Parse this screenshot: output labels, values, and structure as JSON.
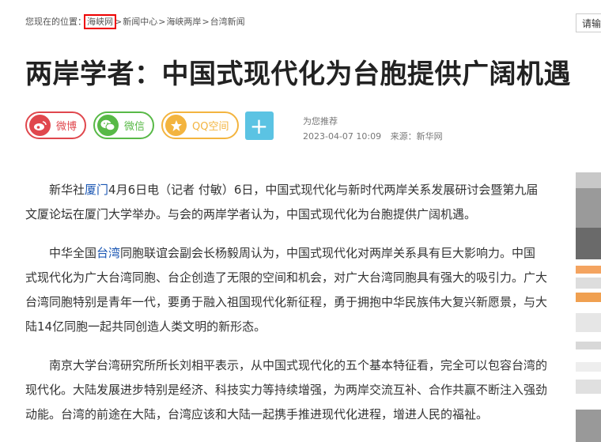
{
  "breadcrumb": {
    "prefix": "您现在的位置：",
    "items": [
      "海峡网",
      "新闻中心",
      "海峡两岸",
      "台湾新闻"
    ],
    "separator": ">"
  },
  "header": {
    "login_label": "请输"
  },
  "article": {
    "title": "两岸学者：中国式现代化为台胞提供广阔机遇",
    "recommend_label": "为您推荐",
    "date": "2023-04-07 10:09",
    "source_label": "来源：",
    "source": "新华网"
  },
  "share": {
    "weibo": "微博",
    "wechat": "微信",
    "qq": "QQ空间",
    "more": "+"
  },
  "content": {
    "p1_a": "新华社",
    "p1_link": "厦门",
    "p1_b": "4月6日电（记者 付敏）6日，中国式现代化与新时代两岸关系发展研讨会暨第九届文厦论坛在厦门大学举办。与会的两岸学者认为，中国式现代化为台胞提供广阔机遇。",
    "p2_a": "中华全国",
    "p2_link": "台湾",
    "p2_b": "同胞联谊会副会长杨毅周认为，中国式现代化对两岸关系具有巨大影响力。中国式现代化为广大台湾同胞、台企创造了无限的空间和机会，对广大台湾同胞具有强大的吸引力。广大台湾同胞特别是青年一代，要勇于融入祖国现代化新征程，勇于拥抱中华民族伟大复兴新愿景，与大陆14亿同胞一起共同创造人类文明的新形态。",
    "p3": "南京大学台湾研究所所长刘相平表示，从中国式现代化的五个基本特征看，完全可以包容台湾的现代化。大陆发展进步特别是经济、科技实力等持续增强，为两岸交流互补、合作共赢不断注入强劲动能。台湾的前途在大陆，台湾应该和大陆一起携手推进现代化进程，增进人民的福祉。"
  },
  "colors": {
    "weibo": "#e0474d",
    "wechat": "#58b947",
    "qq": "#f3b43f",
    "plus": "#5bc3e3",
    "link": "#1a56b3",
    "highlight": "#e00000"
  }
}
